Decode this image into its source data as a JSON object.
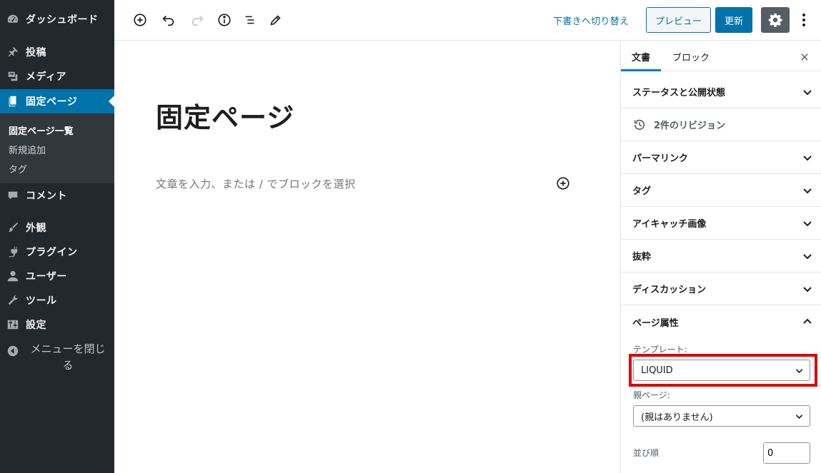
{
  "sidebar": {
    "dashboard": "ダッシュボード",
    "posts": "投稿",
    "media": "メディア",
    "pages": "固定ページ",
    "submenu": {
      "all_pages": "固定ページ一覧",
      "add_new": "新規追加",
      "tags": "タグ"
    },
    "comments": "コメント",
    "appearance": "外観",
    "plugins": "プラグイン",
    "users": "ユーザー",
    "tools": "ツール",
    "settings": "設定",
    "collapse": "メニューを閉じる"
  },
  "toolbar": {
    "switch_to_draft": "下書きへ切り替え",
    "preview": "プレビュー",
    "update": "更新"
  },
  "editor": {
    "title": "固定ページ",
    "placeholder": "文章を入力、または / でブロックを選択"
  },
  "panel": {
    "tabs": {
      "document": "文書",
      "block": "ブロック"
    },
    "sections": {
      "status": "ステータスと公開状態",
      "revisions": "2件のリビジョン",
      "permalink": "パーマリンク",
      "tags": "タグ",
      "featured_image": "アイキャッチ画像",
      "excerpt": "抜粋",
      "discussion": "ディスカッション",
      "page_attributes": "ページ属性"
    },
    "page_attributes": {
      "template_label": "テンプレート:",
      "template_value": "LIQUID",
      "parent_label": "親ページ:",
      "parent_value": "(親はありません)",
      "order_label": "並び順",
      "order_value": "0"
    }
  },
  "colors": {
    "admin_bar": "#23282d",
    "accent": "#0073aa",
    "highlight": "#e00000"
  }
}
